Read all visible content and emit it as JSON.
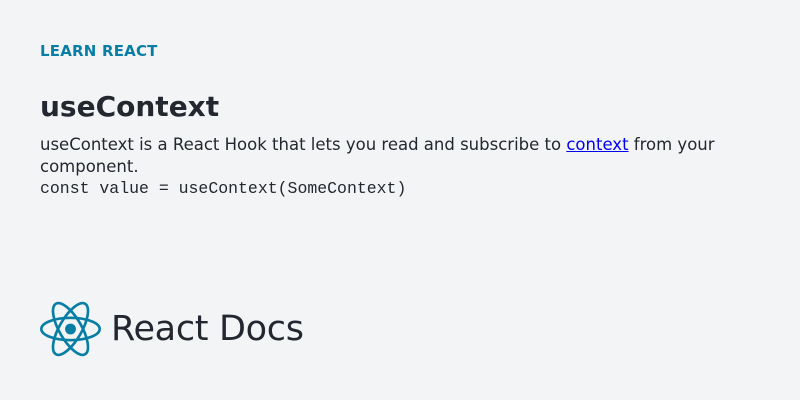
{
  "section": {
    "eyebrow": "LEARN REACT"
  },
  "article": {
    "title": "useContext",
    "description_before": "useContext is a React Hook that lets you read and subscribe to ",
    "description_link": "context",
    "description_after": " from your component.",
    "code": "const value = useContext(SomeContext)"
  },
  "brand": {
    "name": "React Docs",
    "icon": "react-logo-icon",
    "accent_color": "#087ea4"
  }
}
